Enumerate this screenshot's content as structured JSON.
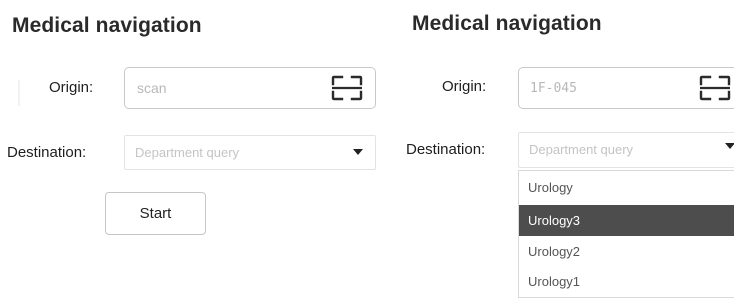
{
  "left_screen": {
    "title": "Medical navigation",
    "origin_label": "Origin:",
    "origin_value": "scan",
    "scan_icon": "scan-qr-icon",
    "destination_label": "Destination:",
    "destination_placeholder": "Department query",
    "destination_caret": "dropdown-caret-icon",
    "start_label": "Start"
  },
  "right_screen": {
    "title": "Medical navigation",
    "origin_label": "Origin:",
    "origin_value": "1F-045",
    "scan_icon": "scan-qr-icon",
    "destination_label": "Destination:",
    "destination_placeholder": "Department query",
    "destination_caret": "dropdown-caret-icon",
    "dropdown_options": [
      {
        "label": "Urology",
        "selected": false
      },
      {
        "label": "Urology3",
        "selected": true
      },
      {
        "label": "Urology2",
        "selected": false
      },
      {
        "label": "Urology1",
        "selected": false
      }
    ],
    "selected_highlight_color": "#4d4d4d"
  }
}
